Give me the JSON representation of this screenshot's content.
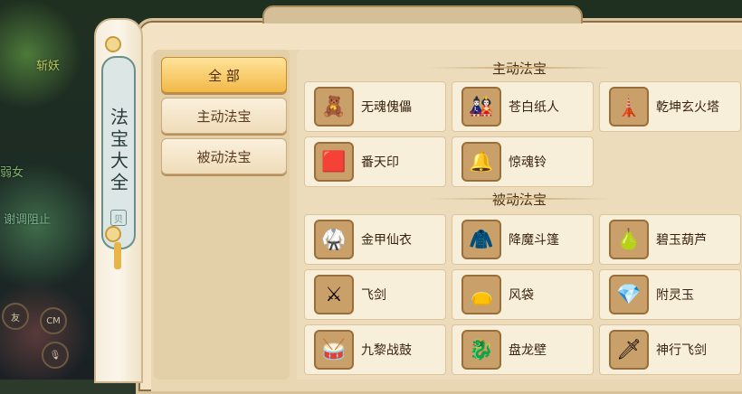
{
  "background": {
    "texts": [
      "斩妖",
      "弱女",
      "谢调阻止",
      "友",
      "CM"
    ]
  },
  "scroll": {
    "title": "法宝大全",
    "knob_char": "贝"
  },
  "categories": [
    {
      "label": "全 部",
      "active": true
    },
    {
      "label": "主动法宝",
      "active": false
    },
    {
      "label": "被动法宝",
      "active": false
    }
  ],
  "sections": [
    {
      "title": "主动法宝",
      "items": [
        {
          "name": "无魂傀儡",
          "icon": "puppet-icon",
          "glyph": "🧸"
        },
        {
          "name": "苍白纸人",
          "icon": "paper-doll-icon",
          "glyph": "🎎"
        },
        {
          "name": "乾坤玄火塔",
          "icon": "pagoda-icon",
          "glyph": "🗼"
        },
        {
          "name": "番天印",
          "icon": "seal-icon",
          "glyph": "🟥"
        },
        {
          "name": "惊魂铃",
          "icon": "bell-icon",
          "glyph": "🔔"
        }
      ]
    },
    {
      "title": "被动法宝",
      "items": [
        {
          "name": "金甲仙衣",
          "icon": "armor-icon",
          "glyph": "🥋"
        },
        {
          "name": "降魔斗篷",
          "icon": "cloak-icon",
          "glyph": "🧥"
        },
        {
          "name": "碧玉葫芦",
          "icon": "gourd-icon",
          "glyph": "🍐"
        },
        {
          "name": "飞剑",
          "icon": "crossed-swords-icon",
          "glyph": "⚔"
        },
        {
          "name": "风袋",
          "icon": "wind-bag-icon",
          "glyph": "👝"
        },
        {
          "name": "附灵玉",
          "icon": "jade-icon",
          "glyph": "💎"
        },
        {
          "name": "九黎战鼓",
          "icon": "drum-icon",
          "glyph": "🥁"
        },
        {
          "name": "盘龙壁",
          "icon": "dragon-wall-icon",
          "glyph": "🐉"
        },
        {
          "name": "神行飞剑",
          "icon": "sword-icon",
          "glyph": "🗡"
        }
      ]
    }
  ]
}
